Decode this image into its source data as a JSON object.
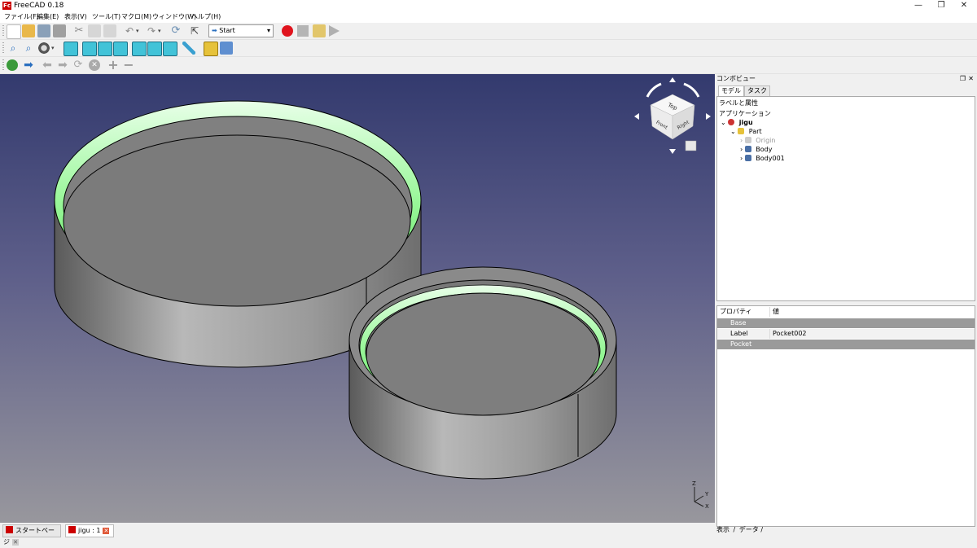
{
  "window": {
    "title": "FreeCAD 0.18",
    "logo": "Fc"
  },
  "menu": [
    "ファイル(F)",
    "編集(E)",
    "表示(V)",
    "ツール(T)",
    "マクロ(M)",
    "ウィンドウ(W)",
    "ヘルプ(H)"
  ],
  "toolbar": {
    "workbench_label": "Start"
  },
  "navcube": {
    "top": "Top",
    "front": "Front",
    "right": "Right"
  },
  "axis": {
    "z": "Z",
    "y": "Y",
    "x": "X"
  },
  "panel": {
    "title": "コンボビュー",
    "tabs": [
      "モデル",
      "タスク"
    ],
    "labels_header": "ラベルと属性",
    "application": "アプリケーション",
    "tree": {
      "doc": "jigu",
      "part": "Part",
      "origin": "Origin",
      "body": "Body",
      "body001": "Body001"
    },
    "props": {
      "col_property": "プロパティ",
      "col_value": "値",
      "group_base": "Base",
      "label_key": "Label",
      "label_value": "Pocket002",
      "group_pocket": "Pocket"
    },
    "bottom_tabs": [
      "表示",
      "データ"
    ]
  },
  "doctabs": [
    "スタートページ",
    "jigu : 1"
  ],
  "colors": {
    "accent_green": "#7cf27e",
    "record_red": "#e0141e",
    "view_top": "#333a6e",
    "view_bottom": "#98979d"
  }
}
